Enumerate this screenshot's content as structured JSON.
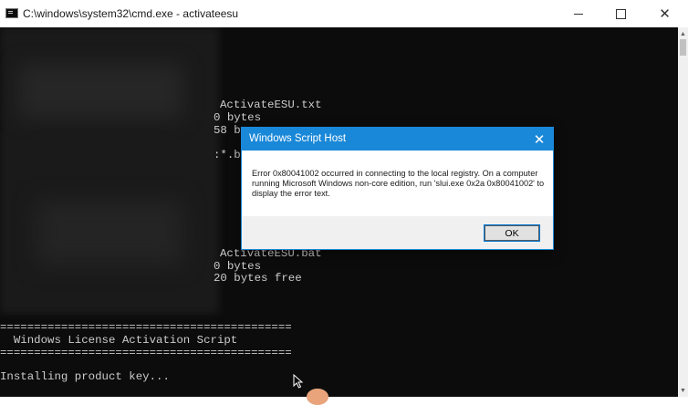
{
  "window": {
    "title": "C:\\windows\\system32\\cmd.exe - activateesu",
    "minimize_icon": "minimize-icon",
    "maximize_icon": "maximize-icon",
    "close_glyph": "✕"
  },
  "console": {
    "lines": [
      "ActivateESU.txt",
      "0 bytes",
      "58 by",
      ":*.ba",
      "ActivateESU.bat",
      "0 bytes",
      "20 bytes free",
      "===========================================",
      "  Windows License Activation Script",
      "===========================================",
      "Installing product key..."
    ]
  },
  "dialog": {
    "title": "Windows Script Host",
    "close_glyph": "✕",
    "message": "Error 0x80041002 occurred in connecting to the local registry. On a computer running Microsoft Windows non-core edition, run 'slui.exe 0x2a 0x80041002' to display the error text.",
    "ok_label": "OK"
  },
  "colors": {
    "console_bg": "#0c0c0c",
    "console_text": "#cccccc",
    "dialog_accent": "#1a88d8"
  }
}
